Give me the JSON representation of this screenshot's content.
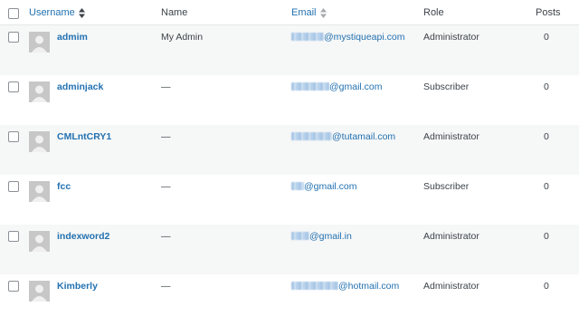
{
  "header": {
    "username": "Username",
    "name": "Name",
    "email": "Email",
    "role": "Role",
    "posts": "Posts"
  },
  "rows": [
    {
      "username": "admim",
      "name": "My Admin",
      "email_domain": "@mystiqueapi.com",
      "role": "Administrator",
      "posts": "0"
    },
    {
      "username": "adminjack",
      "name": "—",
      "email_domain": "@gmail.com",
      "role": "Subscriber",
      "posts": "0"
    },
    {
      "username": "CMLntCRY1",
      "name": "—",
      "email_domain": "@tutamail.com",
      "role": "Administrator",
      "posts": "0"
    },
    {
      "username": "fcc",
      "name": "—",
      "email_domain": "@gmail.com",
      "role": "Subscriber",
      "posts": "0"
    },
    {
      "username": "indexword2",
      "name": "—",
      "email_domain": "@gmail.in",
      "role": "Administrator",
      "posts": "0"
    },
    {
      "username": "Kimberly",
      "name": "—",
      "email_domain": "@hotmail.com",
      "role": "Administrator",
      "posts": "0"
    }
  ],
  "colors": {
    "link": "#2271b1",
    "text": "#3c434a",
    "alt_row": "#f6f7f7",
    "avatar": "#c7c7c7"
  },
  "icons": {
    "sort_username": "sort-active-icon",
    "sort_email": "sort-icon",
    "avatar": "default-avatar-icon"
  }
}
